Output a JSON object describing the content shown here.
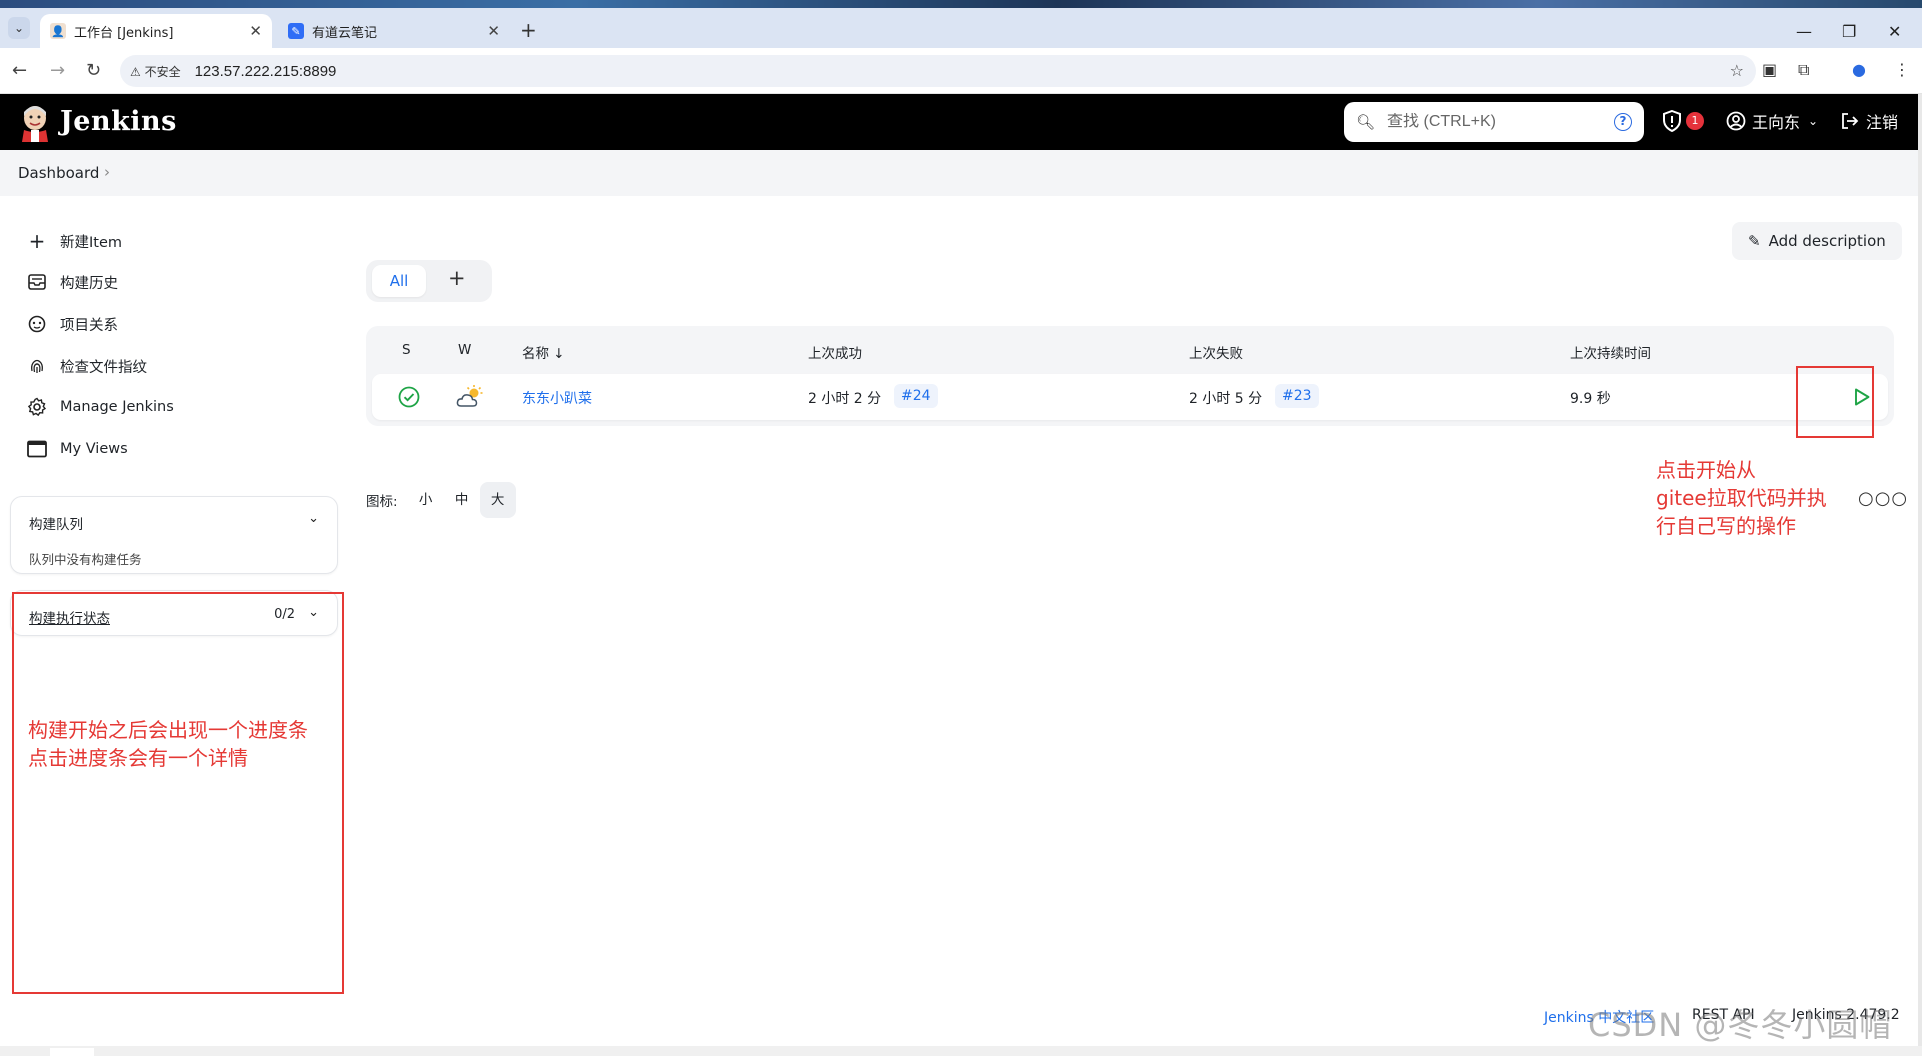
{
  "browser": {
    "tabs": [
      {
        "title": "工作台 [Jenkins]",
        "active": true
      },
      {
        "title": "有道云笔记",
        "active": false
      }
    ],
    "insecure_label": "不安全",
    "url": "123.57.222.215:8899"
  },
  "header": {
    "brand": "Jenkins",
    "search_placeholder": "查找 (CTRL+K)",
    "security_count": "1",
    "user_name": "王向东",
    "logout_label": "注销"
  },
  "breadcrumb": {
    "root": "Dashboard"
  },
  "sidebar": {
    "items": [
      {
        "label": "新建Item",
        "icon": "plus-icon"
      },
      {
        "label": "构建历史",
        "icon": "history-icon"
      },
      {
        "label": "项目关系",
        "icon": "relations-icon"
      },
      {
        "label": "检查文件指纹",
        "icon": "fingerprint-icon"
      },
      {
        "label": "Manage Jenkins",
        "icon": "gear-icon"
      },
      {
        "label": "My Views",
        "icon": "window-icon"
      }
    ],
    "build_queue": {
      "title": "构建队列",
      "empty_text": "队列中没有构建任务"
    },
    "executors": {
      "title": "构建执行状态",
      "count": "0/2"
    }
  },
  "main": {
    "add_description": "Add description",
    "view_tabs": {
      "all": "All",
      "add": "+"
    },
    "table": {
      "headers": {
        "s": "S",
        "w": "W",
        "name": "名称 ↓",
        "last_success": "上次成功",
        "last_failure": "上次失败",
        "last_duration": "上次持续时间"
      },
      "rows": [
        {
          "status": "success",
          "weather": "partly-cloudy",
          "name": "东东小趴菜",
          "last_success_time": "2 小时 2 分",
          "last_success_build": "#24",
          "last_failure_time": "2 小时 5 分",
          "last_failure_build": "#23",
          "last_duration": "9.9 秒"
        }
      ]
    },
    "legend": {
      "label": "图标:",
      "small": "小",
      "medium": "中",
      "large": "大",
      "selected": "大"
    }
  },
  "annotations": {
    "right_line1": "点击开始从",
    "right_line2": "gitee拉取代码并执",
    "right_line3": "行自己写的操作",
    "left_line1": "构建开始之后会出现一个进度条",
    "left_line2": "点击进度条会有一个详情"
  },
  "footer": {
    "community": "Jenkins 中文社区",
    "rest_api": "REST API",
    "version": "Jenkins 2.479.2"
  },
  "watermark": "CSDN @冬冬小圆帽",
  "colors": {
    "accent": "#1f6feb",
    "annotation": "#e53935",
    "success": "#1ea446",
    "header_bg": "#000000"
  }
}
